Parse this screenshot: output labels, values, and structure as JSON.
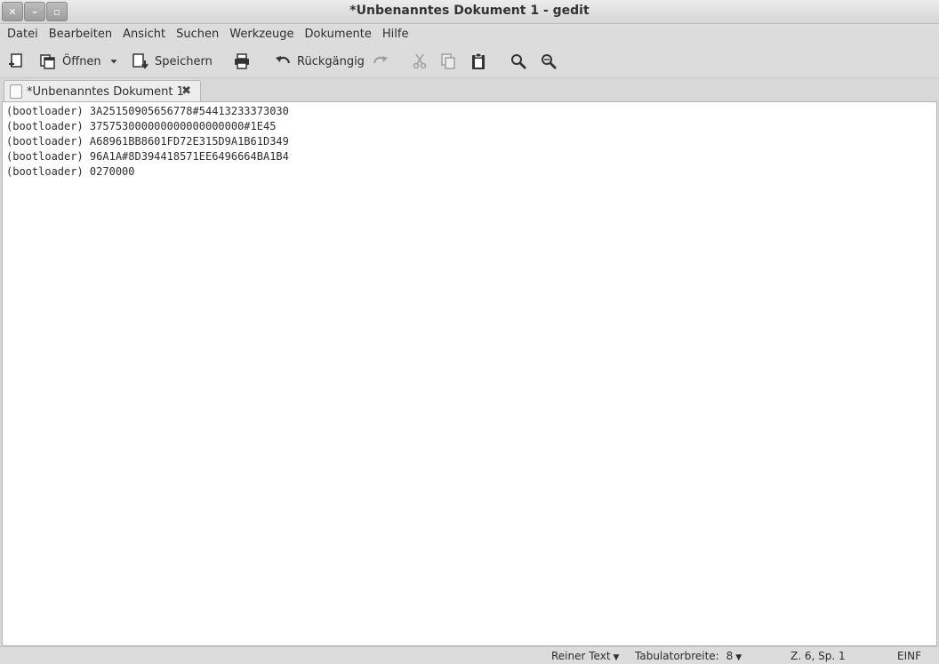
{
  "window": {
    "title": "*Unbenanntes Dokument 1 - gedit"
  },
  "menu": [
    "Datei",
    "Bearbeiten",
    "Ansicht",
    "Suchen",
    "Werkzeuge",
    "Dokumente",
    "Hilfe"
  ],
  "toolbar": {
    "open_label": "Öffnen",
    "save_label": "Speichern",
    "undo_label": "Rückgängig"
  },
  "tab": {
    "label": "*Unbenanntes Dokument 1"
  },
  "editor": {
    "lines": [
      "(bootloader) 3A25150905656778#54413233373030",
      "(bootloader) 375753000000000000000000#1E45",
      "(bootloader) A68961BB8601FD72E315D9A1B61D349",
      "(bootloader) 96A1A#8D394418571EE6496664BA1B4",
      "(bootloader) 0270000"
    ]
  },
  "status": {
    "syntax": "Reiner Text",
    "tab_width_label": "Tabulatorbreite:",
    "tab_width": "8",
    "position": "Z. 6, Sp. 1",
    "mode": "EINF"
  }
}
